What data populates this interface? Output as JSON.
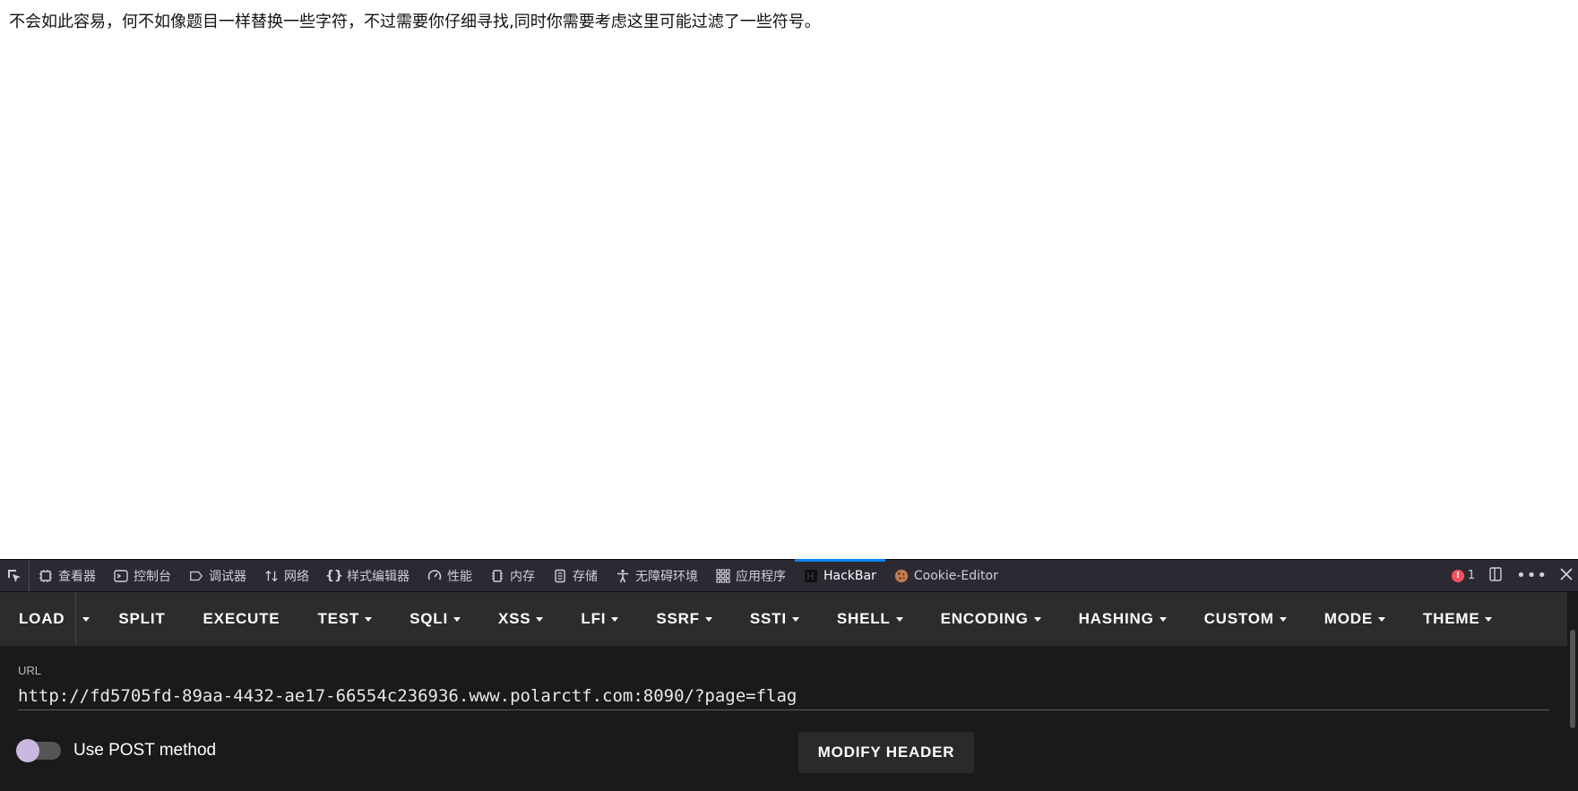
{
  "page": {
    "text": "不会如此容易，何不如像题目一样替换一些字符，不过需要你仔细寻找,同时你需要考虑这里可能过滤了一些符号。"
  },
  "devtools": {
    "tabs": [
      {
        "label": "查看器",
        "icon": "inspector-icon"
      },
      {
        "label": "控制台",
        "icon": "console-icon"
      },
      {
        "label": "调试器",
        "icon": "debugger-icon"
      },
      {
        "label": "网络",
        "icon": "network-icon"
      },
      {
        "label": "样式编辑器",
        "icon": "style-editor-icon"
      },
      {
        "label": "性能",
        "icon": "performance-icon"
      },
      {
        "label": "内存",
        "icon": "memory-icon"
      },
      {
        "label": "存储",
        "icon": "storage-icon"
      },
      {
        "label": "无障碍环境",
        "icon": "accessibility-icon"
      },
      {
        "label": "应用程序",
        "icon": "application-icon"
      },
      {
        "label": "HackBar",
        "icon": "hackbar-icon"
      },
      {
        "label": "Cookie-Editor",
        "icon": "cookie-icon"
      }
    ],
    "active_tab": "HackBar",
    "error_count": "1",
    "accent_color": "#0a84ff"
  },
  "hackbar": {
    "toolbar": {
      "load": "LOAD",
      "split": "SPLIT",
      "execute": "EXECUTE",
      "test": "TEST",
      "sqli": "SQLI",
      "xss": "XSS",
      "lfi": "LFI",
      "ssrf": "SSRF",
      "ssti": "SSTI",
      "shell": "SHELL",
      "encoding": "ENCODING",
      "hashing": "HASHING",
      "custom": "CUSTOM",
      "mode": "MODE",
      "theme": "THEME"
    },
    "url_label": "URL",
    "url_value": "http://fd5705fd-89aa-4432-ae17-66554c236936.www.polarctf.com:8090/?page=flag",
    "post_label": "Use POST method",
    "post_enabled": false,
    "modify_header": "MODIFY HEADER"
  }
}
